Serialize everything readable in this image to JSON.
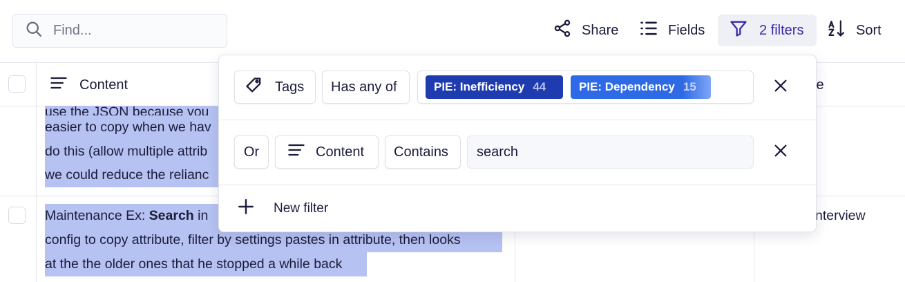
{
  "toolbar": {
    "search_placeholder": "Find...",
    "share_label": "Share",
    "fields_label": "Fields",
    "filters_label": "2 filters",
    "sort_label": "Sort"
  },
  "table": {
    "columns": [
      {
        "label": "Content",
        "icon": "text-align-icon"
      },
      {
        "label": "te"
      }
    ],
    "rows": [
      {
        "lines": [
          "use the JSON because you",
          "easier to copy when we hav",
          "do this (allow multiple attrib",
          "we could reduce the relianc"
        ]
      },
      {
        "prefix": "Maintenance Ex: ",
        "bold": "Search",
        "line1_rest": " in",
        "lines": [
          "config to copy attribute, filter by settings pastes in attribute, then looks",
          "at the the older ones that he stopped a while back"
        ],
        "source": "nterview"
      }
    ]
  },
  "filter_popover": {
    "row1": {
      "field_label": "Tags",
      "operator": "Has any of",
      "chips": [
        {
          "label": "PIE: Inefficiency",
          "count": "44",
          "color": "#1f3bb0"
        },
        {
          "label": "PIE: Dependency",
          "count": "15",
          "color": "#2f6ae6"
        }
      ]
    },
    "row2": {
      "conjunction": "Or",
      "field_label": "Content",
      "operator": "Contains",
      "value": "search"
    },
    "new_filter_label": "New filter"
  },
  "colors": {
    "accent": "#3a2aa8",
    "highlight": "#b6c2f2",
    "text": "#1b1c3a"
  }
}
